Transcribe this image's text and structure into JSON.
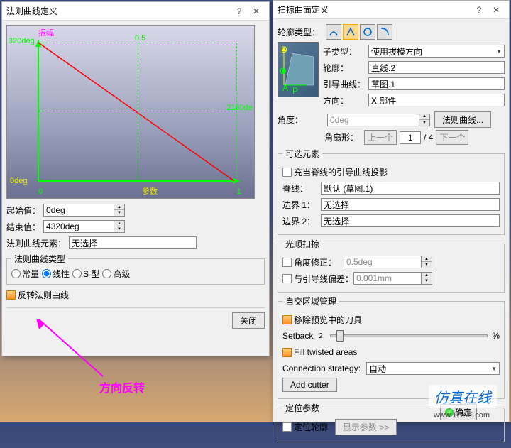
{
  "dialog1": {
    "title": "法则曲线定义",
    "graph": {
      "ylabel": "振幅",
      "xlabel": "参数",
      "topLeft": "320deg",
      "topMid": "0.5",
      "rightMid": "2160de",
      "botLeft": "0deg",
      "x0": "0",
      "x1": "1"
    },
    "startValue": {
      "label": "起始值：",
      "value": "0deg"
    },
    "endValue": {
      "label": "结束值：",
      "value": "4320deg"
    },
    "elementLabel": "法则曲线元素：",
    "elementValue": "无选择",
    "typeGroupTitle": "法则曲线类型",
    "radios": {
      "constant": "常量",
      "linear": "线性",
      "stype": "S 型",
      "advanced": "高级"
    },
    "reverseLabel": "反转法则曲线",
    "closeBtn": "关闭",
    "annotation": "方向反转"
  },
  "dialog2": {
    "title": "扫掠曲面定义",
    "profileTypeLabel": "轮廓类型：",
    "subtypeLabel": "子类型：",
    "subtypeValue": "使用拔模方向",
    "profileLabel": "轮廓：",
    "profileValue": "直线.2",
    "guideLabel": "引导曲线：",
    "guideValue": "草图.1",
    "directionLabel": "方向：",
    "directionValue": "X 部件",
    "angleLabel": "角度：",
    "angleValue": "0deg",
    "lawButton": "法则曲线...",
    "fanLabel": "角扇形：",
    "prevBtn": "上一个",
    "fanValue": "1",
    "fanTotal": "/ 4",
    "nextBtn": "下一个",
    "optionalGroup": "可选元素",
    "projectionLabel": "充当脊线的引导曲线投影",
    "spineLabel": "脊线：",
    "spineValue": "默认 (草图.1)",
    "boundary1Label": "边界 1：",
    "boundary1Value": "无选择",
    "boundary2Label": "边界 2：",
    "boundary2Value": "无选择",
    "smoothGroup": "光顺扫掠",
    "angleCorrLabel": "角度修正：",
    "angleCorrValue": "0.5deg",
    "devLabel": "与引导线偏差：",
    "devValue": "0.001mm",
    "selfIntGroup": "自交区域管理",
    "removeCutterLabel": "移除预览中的刀具",
    "setbackLabel": "Setback",
    "setbackValue": "2",
    "setbackPercent": "%",
    "fillTwisted": "Fill twisted areas",
    "connStrategyLabel": "Connection strategy:",
    "connStrategyValue": "自动",
    "addCutterBtn": "Add cutter",
    "posParamGroup": "定位参数",
    "posProfileLabel": "定位轮廓",
    "showParamsBtn": "显示参数 >>",
    "okBtn": "确定"
  },
  "watermark": {
    "main": "仿真在线",
    "sub": "www.1CAE.com"
  },
  "chart_data": {
    "type": "line",
    "title": "",
    "xlabel": "参数",
    "ylabel": "振幅",
    "x": [
      0,
      1
    ],
    "y": [
      320,
      0
    ],
    "xlim": [
      0,
      1
    ],
    "ylim": [
      0,
      320
    ],
    "annotations": [
      "0.5",
      "2160de",
      "0deg"
    ],
    "series": [
      {
        "name": "法则曲线",
        "x": [
          0,
          1
        ],
        "y": [
          320,
          0
        ],
        "color": "#ff0000"
      }
    ]
  }
}
